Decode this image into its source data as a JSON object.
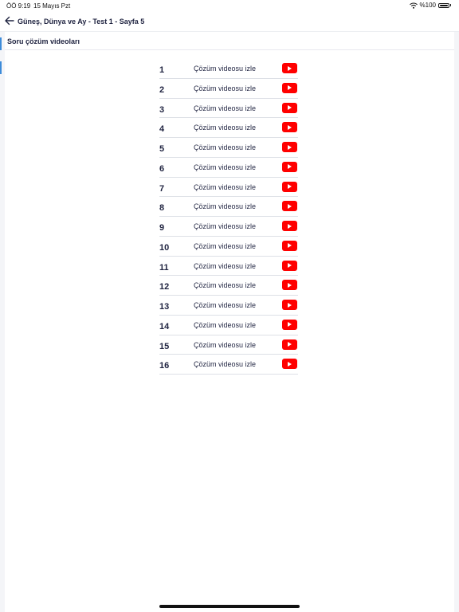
{
  "status_bar": {
    "time": "ÖÖ 9:19",
    "date": "15 Mayıs Pzt",
    "battery": "%100",
    "wifi_icon": "wifi-icon",
    "battery_icon": "battery-icon"
  },
  "nav": {
    "back_icon": "arrow-left-icon",
    "title": "Güneş, Dünya ve Ay - Test 1 - Sayfa 5"
  },
  "section": {
    "title": "Soru çözüm videoları"
  },
  "videos": [
    {
      "number": "1",
      "label": "Çözüm videosu izle"
    },
    {
      "number": "2",
      "label": "Çözüm videosu izle"
    },
    {
      "number": "3",
      "label": "Çözüm videosu izle"
    },
    {
      "number": "4",
      "label": "Çözüm videosu izle"
    },
    {
      "number": "5",
      "label": "Çözüm videosu izle"
    },
    {
      "number": "6",
      "label": "Çözüm videosu izle"
    },
    {
      "number": "7",
      "label": "Çözüm videosu izle"
    },
    {
      "number": "8",
      "label": "Çözüm videosu izle"
    },
    {
      "number": "9",
      "label": "Çözüm videosu izle"
    },
    {
      "number": "10",
      "label": "Çözüm videosu izle"
    },
    {
      "number": "11",
      "label": "Çözüm videosu izle"
    },
    {
      "number": "12",
      "label": "Çözüm videosu izle"
    },
    {
      "number": "13",
      "label": "Çözüm videosu izle"
    },
    {
      "number": "14",
      "label": "Çözüm videosu izle"
    },
    {
      "number": "15",
      "label": "Çözüm videosu izle"
    },
    {
      "number": "16",
      "label": "Çözüm videosu izle"
    }
  ],
  "video_icon": "youtube-play-icon",
  "colors": {
    "accent_red": "#ff0000",
    "text_dark": "#1f2340",
    "rail_blue": "#3d8bd9"
  }
}
